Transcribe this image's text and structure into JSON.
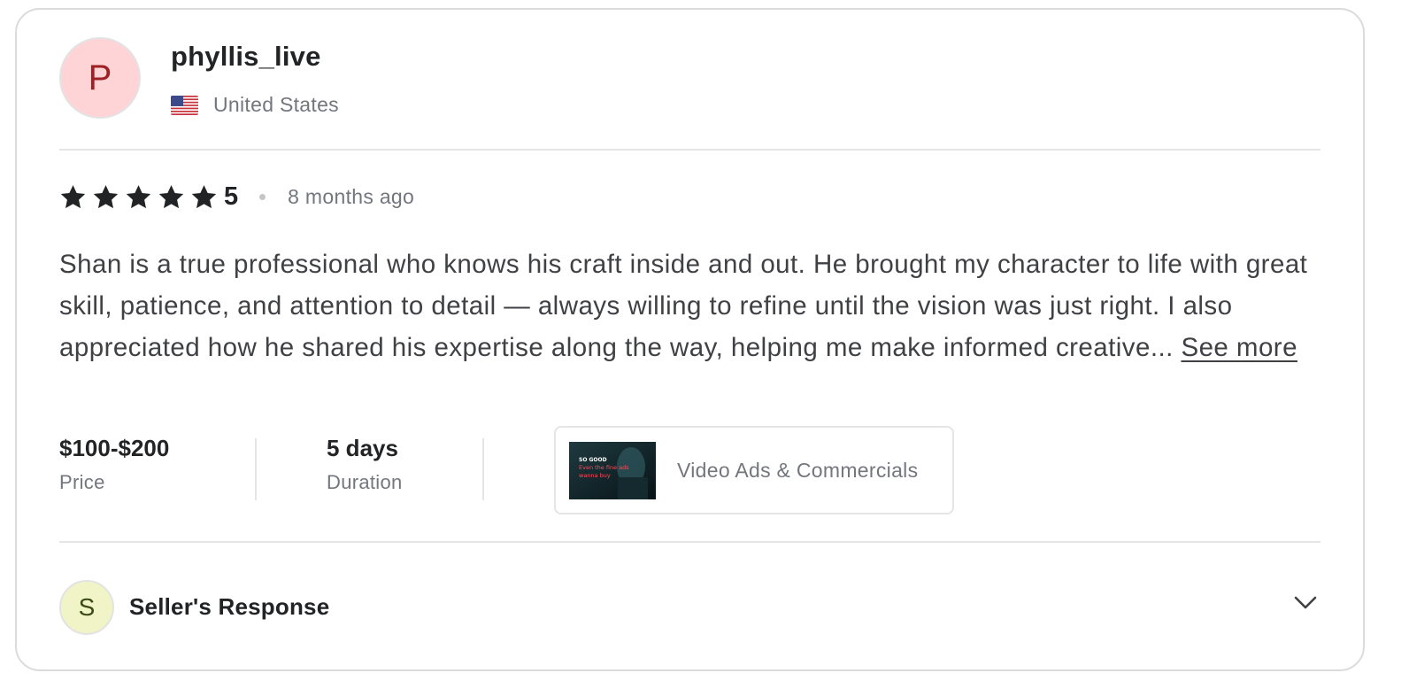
{
  "reviewer": {
    "avatar_letter": "P",
    "username": "phyllis_live",
    "country": "United States",
    "flag_icon": "us-flag-icon"
  },
  "rating": {
    "stars": 5,
    "value": "5",
    "time_ago": "8 months ago"
  },
  "review": {
    "text": "Shan is a true professional who knows his craft inside and out. He brought my character to life with great skill, patience, and attention to detail — always willing to refine until the vision was just right. I also appreciated how he shared his expertise along the way, helping me make informed creative...",
    "see_more": "See more"
  },
  "meta": {
    "price_value": "$100-$200",
    "price_label": "Price",
    "duration_value": "5 days",
    "duration_label": "Duration",
    "gig_title": "Video Ads & Commercials",
    "gig_thumb_caption": [
      "SO GOOD",
      "Even the fine ads",
      "wanna buy"
    ]
  },
  "seller_response": {
    "avatar_letter": "S",
    "title": "Seller's Response",
    "expand_icon": "chevron-down-icon"
  },
  "colors": {
    "star": "#222325",
    "avatar_p_bg": "#ffd4d6",
    "avatar_s_bg": "#f1f4c6",
    "muted_text": "#74767e",
    "border": "#dadbdd"
  }
}
